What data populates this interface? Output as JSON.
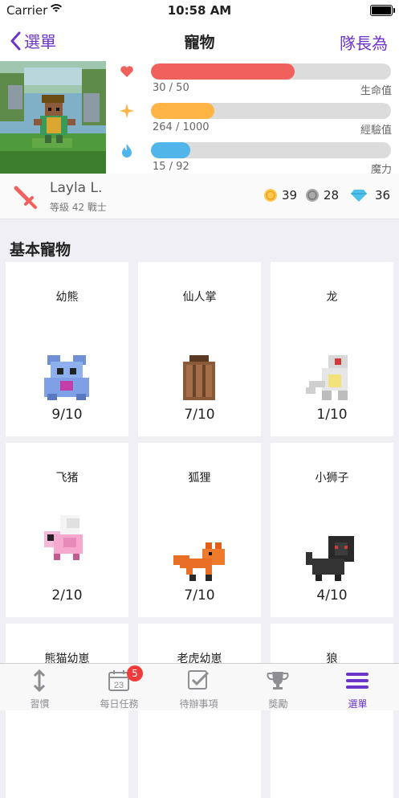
{
  "status": {
    "carrier": "Carrier",
    "time": "10:58 AM"
  },
  "nav": {
    "back": "選單",
    "title": "寵物",
    "right": "隊長為"
  },
  "stats": {
    "health": {
      "text": "30 / 50",
      "label": "生命值",
      "fraction": 0.6,
      "color": "#f0605d"
    },
    "experience": {
      "text": "264 / 1000",
      "label": "經驗值",
      "fraction": 0.264,
      "color": "#ffb445"
    },
    "mana": {
      "text": "15 / 92",
      "label": "魔力",
      "fraction": 0.163,
      "color": "#50b5e9"
    }
  },
  "user": {
    "name": "Layla L.",
    "level": "等級 42 戰士",
    "gold": "39",
    "hourglass": "28",
    "gems": "36"
  },
  "section_title": "基本寵物",
  "pets": [
    {
      "name": "幼熊",
      "count": "9/10"
    },
    {
      "name": "仙人掌",
      "count": "7/10"
    },
    {
      "name": "龙",
      "count": "1/10"
    },
    {
      "name": "飞猪",
      "count": "2/10"
    },
    {
      "name": "狐狸",
      "count": "7/10"
    },
    {
      "name": "小狮子",
      "count": "4/10"
    },
    {
      "name": "熊猫幼崽",
      "count": ""
    },
    {
      "name": "老虎幼崽",
      "count": ""
    },
    {
      "name": "狼",
      "count": ""
    }
  ],
  "tabs": [
    {
      "label": "習慣",
      "icon": "habits-icon"
    },
    {
      "label": "每日任務",
      "icon": "calendar-icon",
      "badge": "5",
      "day": "23"
    },
    {
      "label": "待辦事項",
      "icon": "checklist-icon"
    },
    {
      "label": "獎勵",
      "icon": "trophy-icon"
    },
    {
      "label": "選單",
      "icon": "menu-icon",
      "active": true
    }
  ],
  "colors": {
    "accent": "#6b35c9",
    "health": "#f0605d",
    "experience": "#ffb445",
    "mana": "#50b5e9",
    "badge": "#f23b3b"
  }
}
